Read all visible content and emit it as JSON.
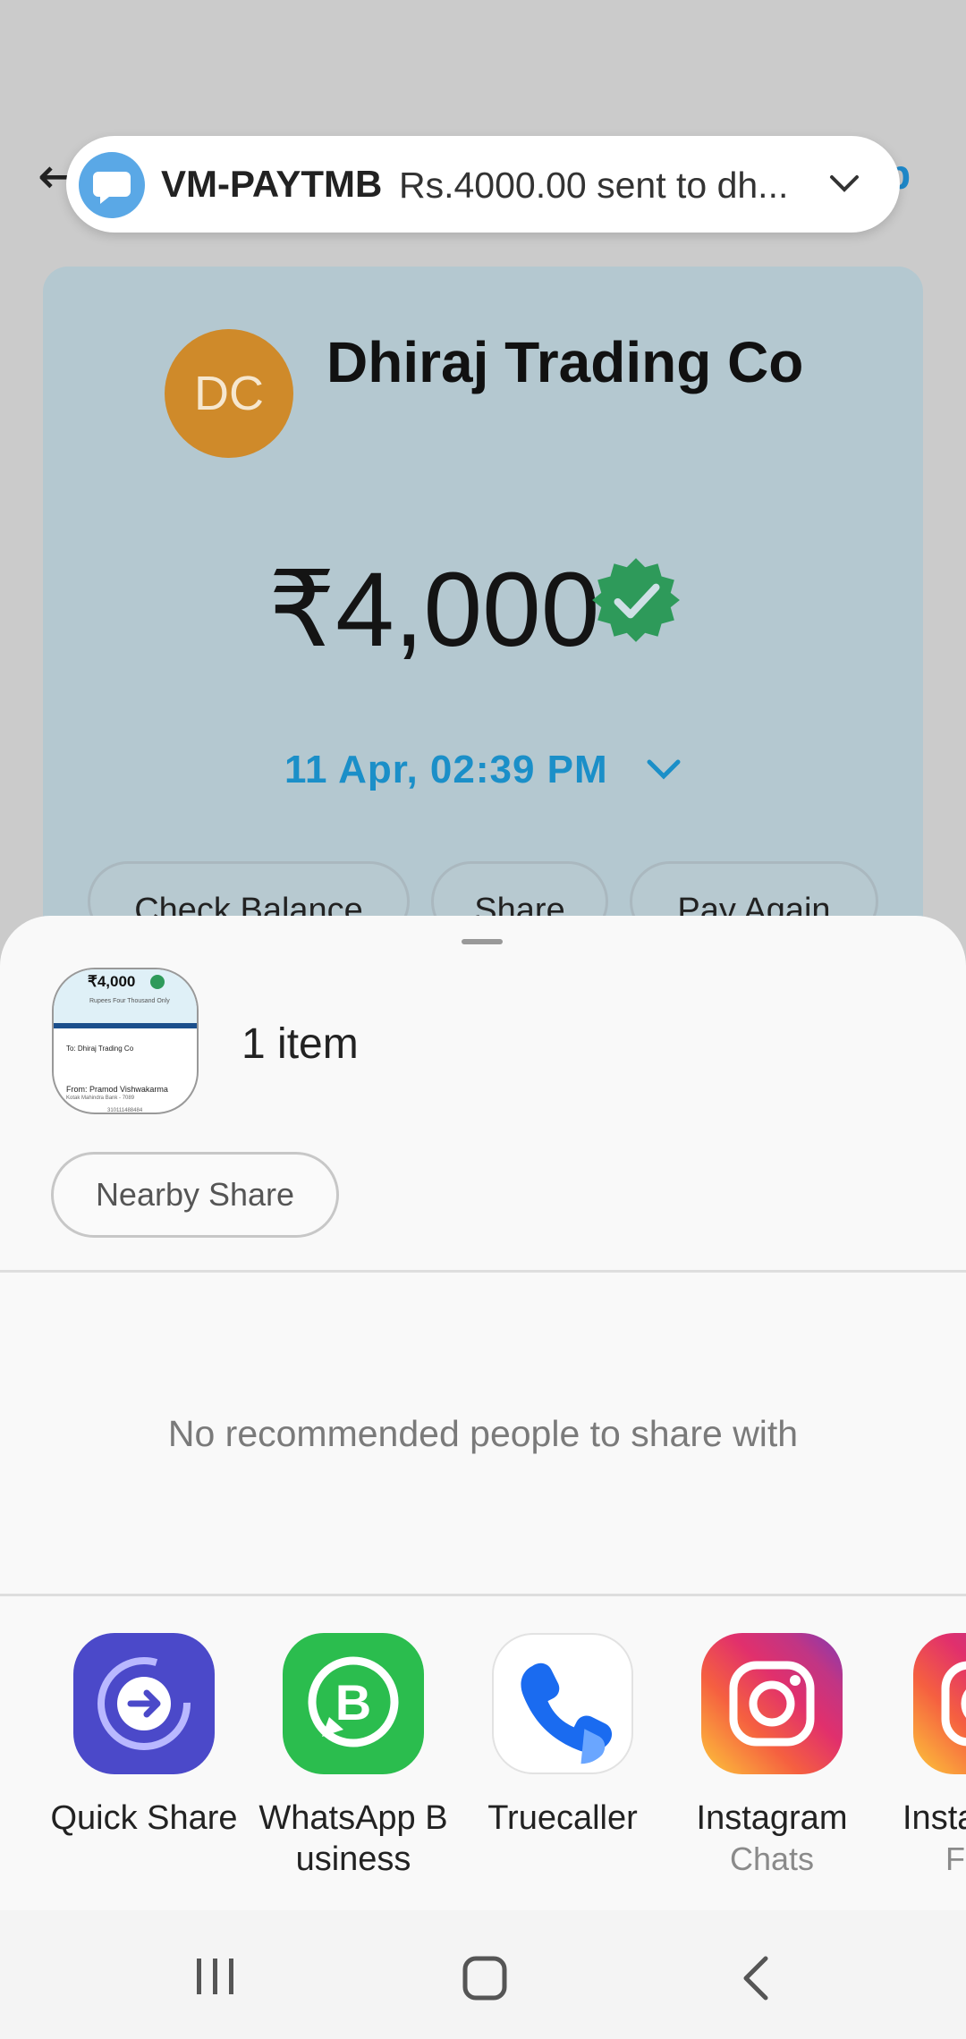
{
  "background_app": {
    "merchant_initials": "DC",
    "merchant_name": "Dhiraj Trading Co",
    "amount": "₹4,000",
    "datetime": "11 Apr, 02:39 PM",
    "buttons": [
      "Check Balance",
      "Share",
      "Pay Again"
    ]
  },
  "notification": {
    "sender": "VM-PAYTMB",
    "message": "Rs.4000.00 sent to dh..."
  },
  "share_sheet": {
    "item_count": "1 item",
    "thumb": {
      "amount": "₹4,000",
      "words": "Rupees Four Thousand Only",
      "to": "To: Dhiraj Trading Co",
      "from": "From: Pramod Vishwakarma",
      "bank": "Kotak Mahindra Bank - 7089",
      "ref": "310111488484"
    },
    "nearby_share": "Nearby Share",
    "no_people": "No recommended people to share with",
    "apps": [
      {
        "label": "Quick Share",
        "sub": ""
      },
      {
        "label": "WhatsApp B usiness",
        "sub": ""
      },
      {
        "label": "Truecaller",
        "sub": ""
      },
      {
        "label": "Instagram",
        "sub": "Chats"
      },
      {
        "label": "Insta",
        "sub": "F"
      }
    ]
  },
  "colors": {
    "accent_blue": "#1b8fc8",
    "avatar": "#cf8a2a",
    "verified_green": "#2e9a5a"
  }
}
